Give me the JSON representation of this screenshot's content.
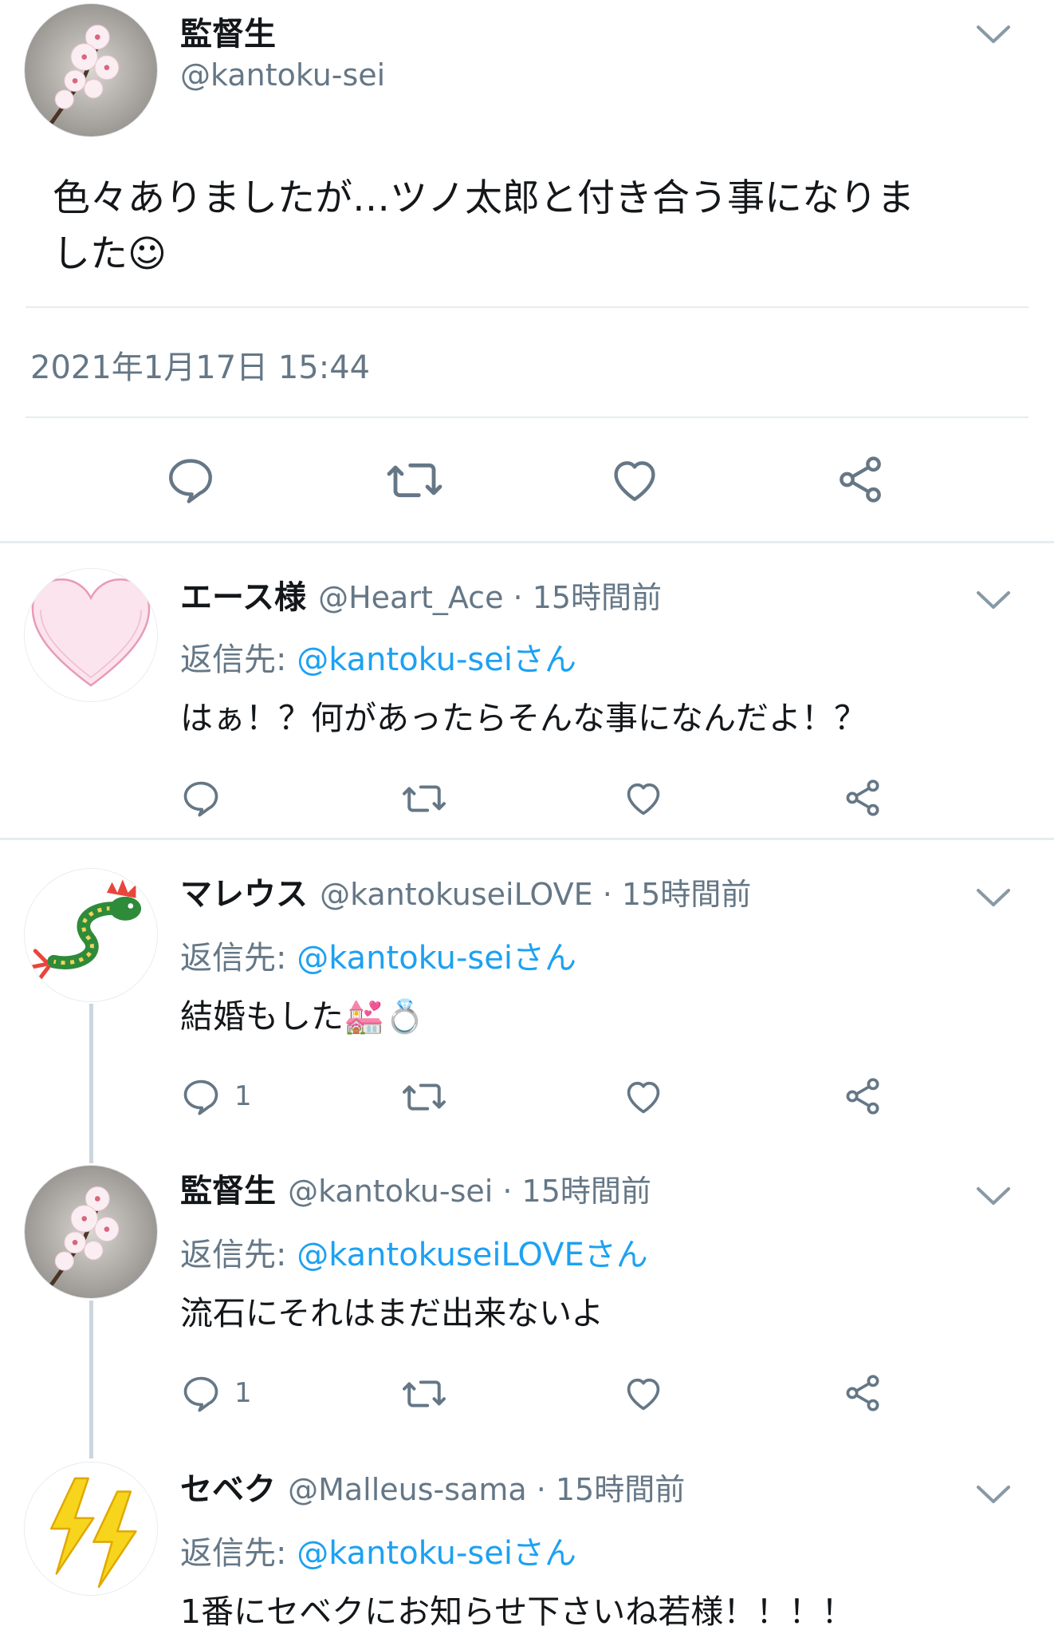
{
  "main_tweet": {
    "name": "監督生",
    "handle": "@kantoku-sei",
    "text_line1": "色々ありましたが…ツノ太郎と付き合う事になりま",
    "text_line2": "した☺",
    "timestamp": "2021年1月17日 15:44"
  },
  "replies": [
    {
      "name": "エース様",
      "meta": "@Heart_Ace · 15時間前",
      "reply_prefix": "返信先: ",
      "reply_link": "@kantoku-seiさん",
      "text": "はぁ！？何があったらそんな事になんだよ！？",
      "reply_count": ""
    },
    {
      "name": "マレウス",
      "meta": "@kantokuseiLOVE · 15時間前",
      "reply_prefix": "返信先: ",
      "reply_link": "@kantoku-seiさん",
      "text": "結婚もした💒💍",
      "reply_count": "1"
    },
    {
      "name": "監督生",
      "meta": "@kantoku-sei · 15時間前",
      "reply_prefix": "返信先: ",
      "reply_link": "@kantokuseiLOVEさん",
      "text": "流石にそれはまだ出来ないよ",
      "reply_count": "1"
    },
    {
      "name": "セベク",
      "meta": "@Malleus-sama · 15時間前",
      "reply_prefix": "返信先: ",
      "reply_link": "@kantoku-seiさん",
      "text": "1番にセベクにお知らせ下さいね若様！！！！",
      "reply_count": ""
    }
  ],
  "icons": [
    "chevron-down-icon",
    "reply-icon",
    "retweet-icon",
    "like-icon",
    "share-icon",
    "cherry-blossom-avatar",
    "heart-avatar",
    "dragon-avatar",
    "lightning-avatar"
  ],
  "colors": {
    "link": "#1da1f2",
    "secondary": "#657786",
    "icon": "#657786",
    "divider": "#e6ecf0"
  }
}
